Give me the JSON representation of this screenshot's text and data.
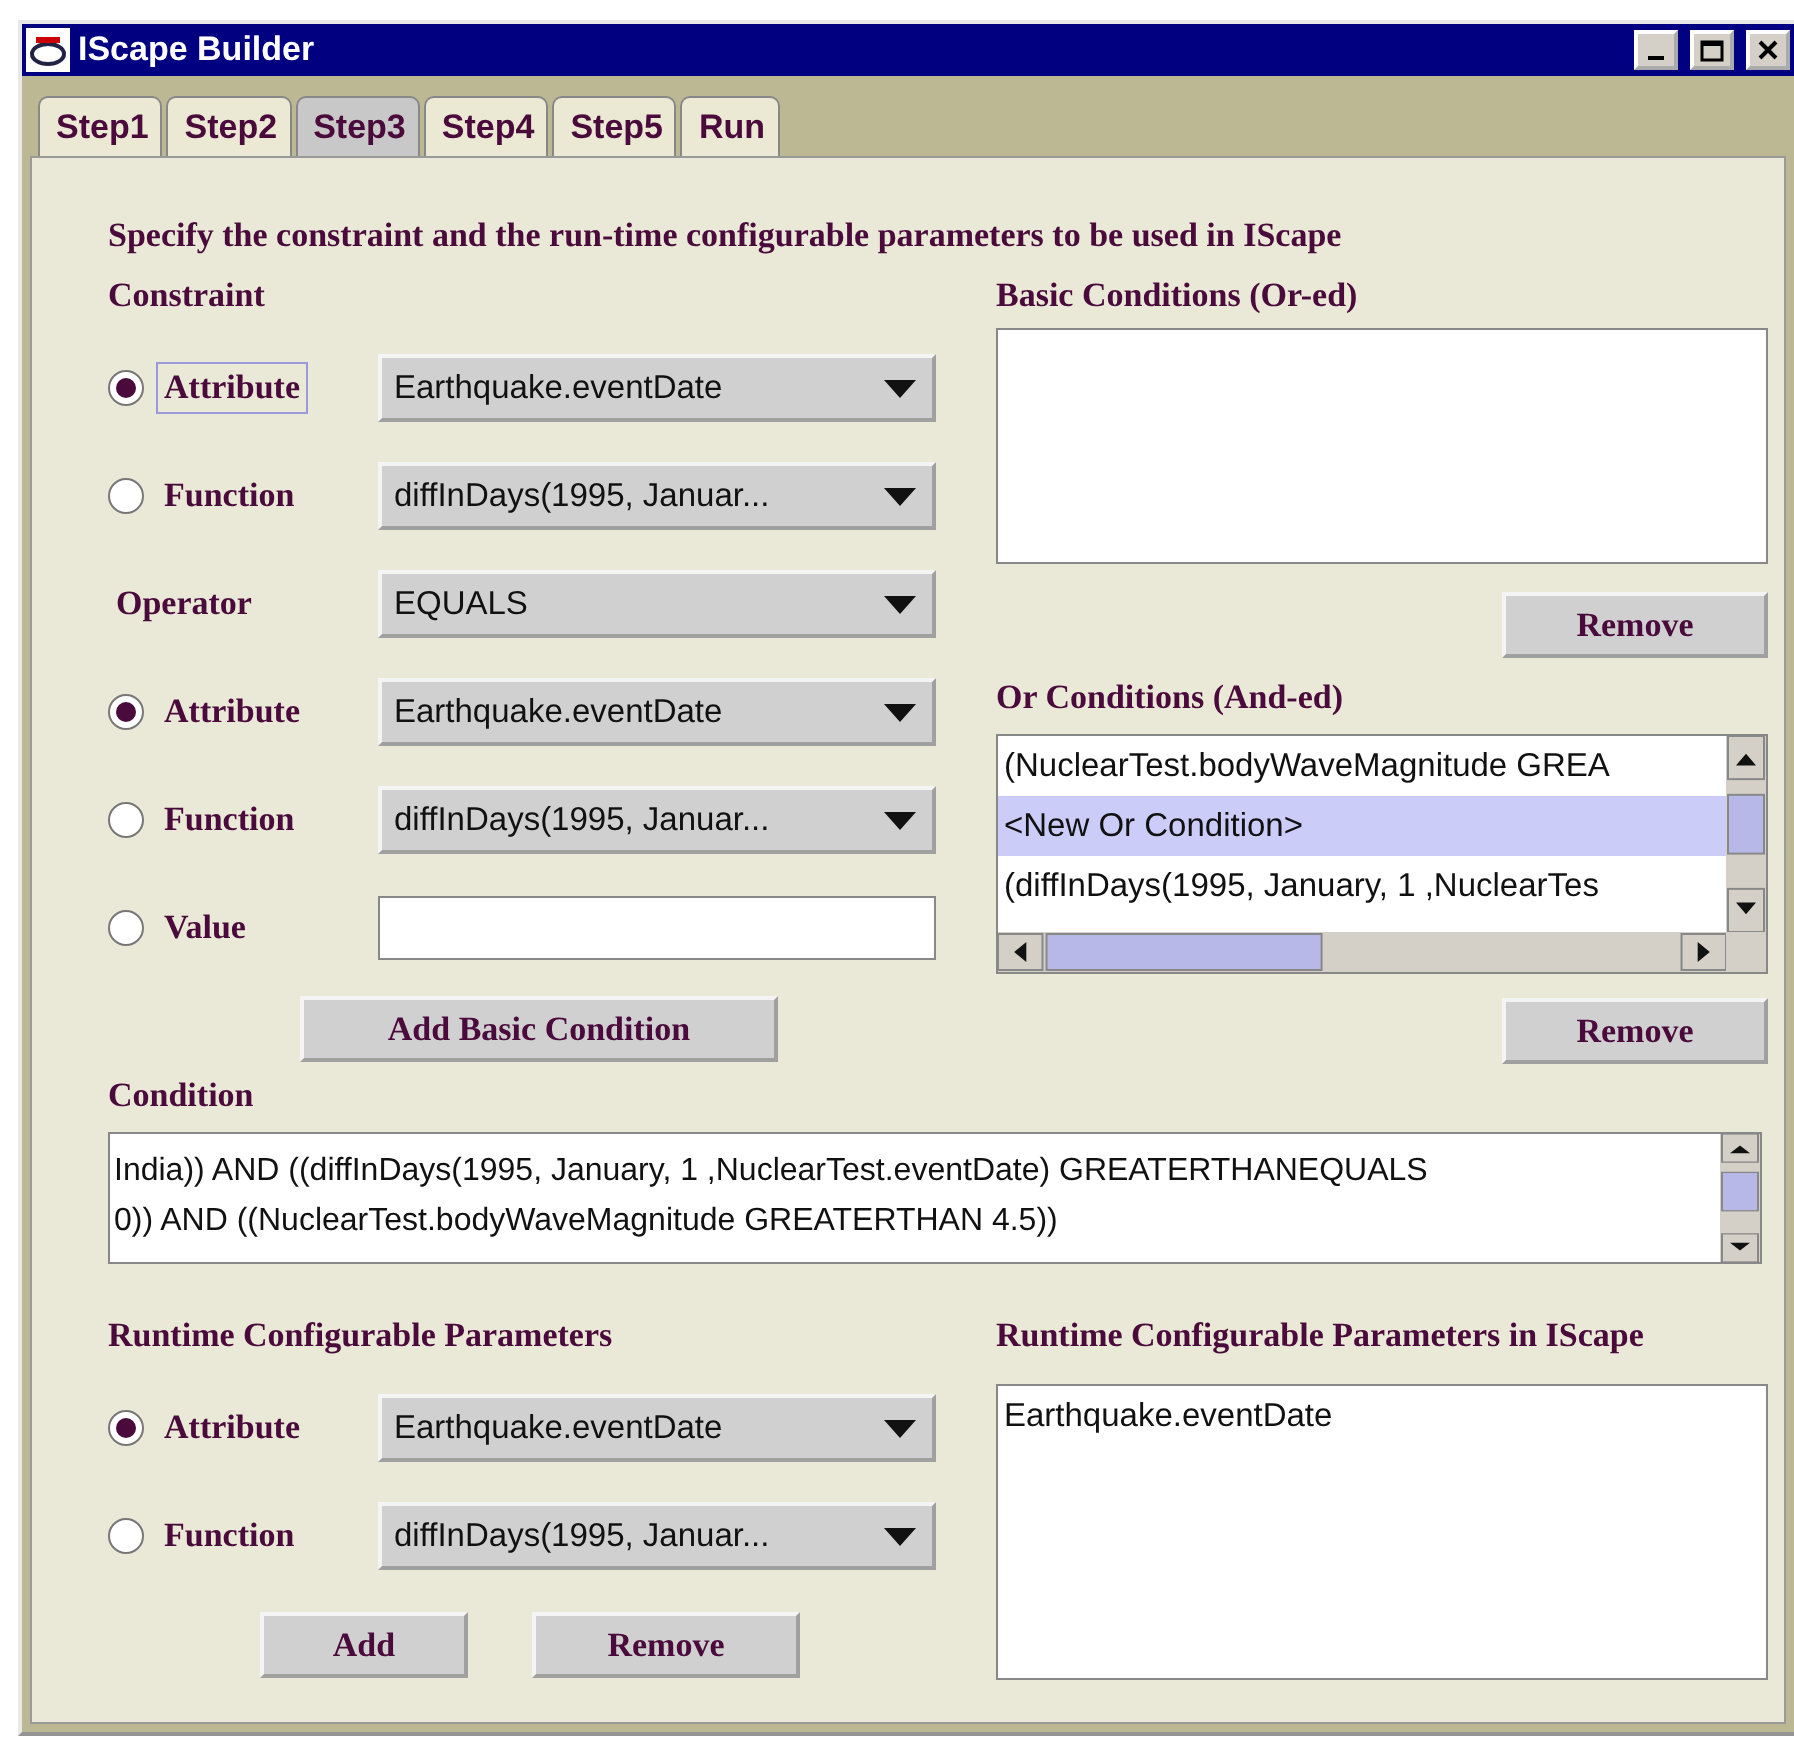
{
  "window": {
    "title": "IScape Builder"
  },
  "tabs": [
    {
      "label": "Step1",
      "selected": false
    },
    {
      "label": "Step2",
      "selected": false
    },
    {
      "label": "Step3",
      "selected": true
    },
    {
      "label": "Step4",
      "selected": false
    },
    {
      "label": "Step5",
      "selected": false
    },
    {
      "label": "Run",
      "selected": false
    }
  ],
  "instruction": "Specify the constraint and the run-time configurable parameters to be used in IScape",
  "constraint": {
    "heading": "Constraint",
    "options": [
      {
        "kind": "combo",
        "label": "Attribute",
        "selected": true,
        "focused": true,
        "value": "Earthquake.eventDate"
      },
      {
        "kind": "combo",
        "label": "Function",
        "selected": false,
        "focused": false,
        "value": "diffInDays(1995, Januar..."
      }
    ]
  },
  "operator": {
    "label": "Operator",
    "value": "EQUALS",
    "options": [
      {
        "kind": "combo",
        "label": "Attribute",
        "selected": true,
        "focused": false,
        "value": "Earthquake.eventDate"
      },
      {
        "kind": "combo",
        "label": "Function",
        "selected": false,
        "focused": false,
        "value": "diffInDays(1995, Januar..."
      },
      {
        "kind": "field",
        "label": "Value",
        "selected": false,
        "focused": false
      }
    ]
  },
  "add_basic_condition": "Add Basic Condition",
  "basic_conditions": {
    "heading": "Basic Conditions (Or-ed)",
    "button": "Remove"
  },
  "or_conditions": {
    "heading": "Or Conditions (And-ed)",
    "items": [
      {
        "text": "(NuclearTest.bodyWaveMagnitude GREA",
        "selected": false
      },
      {
        "text": "<New Or Condition>",
        "selected": true
      },
      {
        "text": "(diffInDays(1995, January, 1 ,NuclearTes",
        "selected": false
      }
    ],
    "button": "Remove"
  },
  "condition": {
    "heading": "Condition",
    "lines": [
      "India)) AND ((diffInDays(1995, January, 1 ,NuclearTest.eventDate) GREATERTHANEQUALS",
      "0)) AND ((NuclearTest.bodyWaveMagnitude GREATERTHAN 4.5))"
    ]
  },
  "runtime": {
    "heading": "Runtime Configurable Parameters",
    "options": [
      {
        "kind": "combo",
        "label": "Attribute",
        "selected": true,
        "focused": false,
        "value": "Earthquake.eventDate"
      },
      {
        "kind": "combo",
        "label": "Function",
        "selected": false,
        "focused": false,
        "value": "diffInDays(1995, Januar..."
      }
    ],
    "buttons": [
      "Add",
      "Remove"
    ]
  },
  "runtime_in_iscape": {
    "heading": "Runtime Configurable Parameters in IScape",
    "items": [
      "Earthquake.eventDate"
    ]
  }
}
